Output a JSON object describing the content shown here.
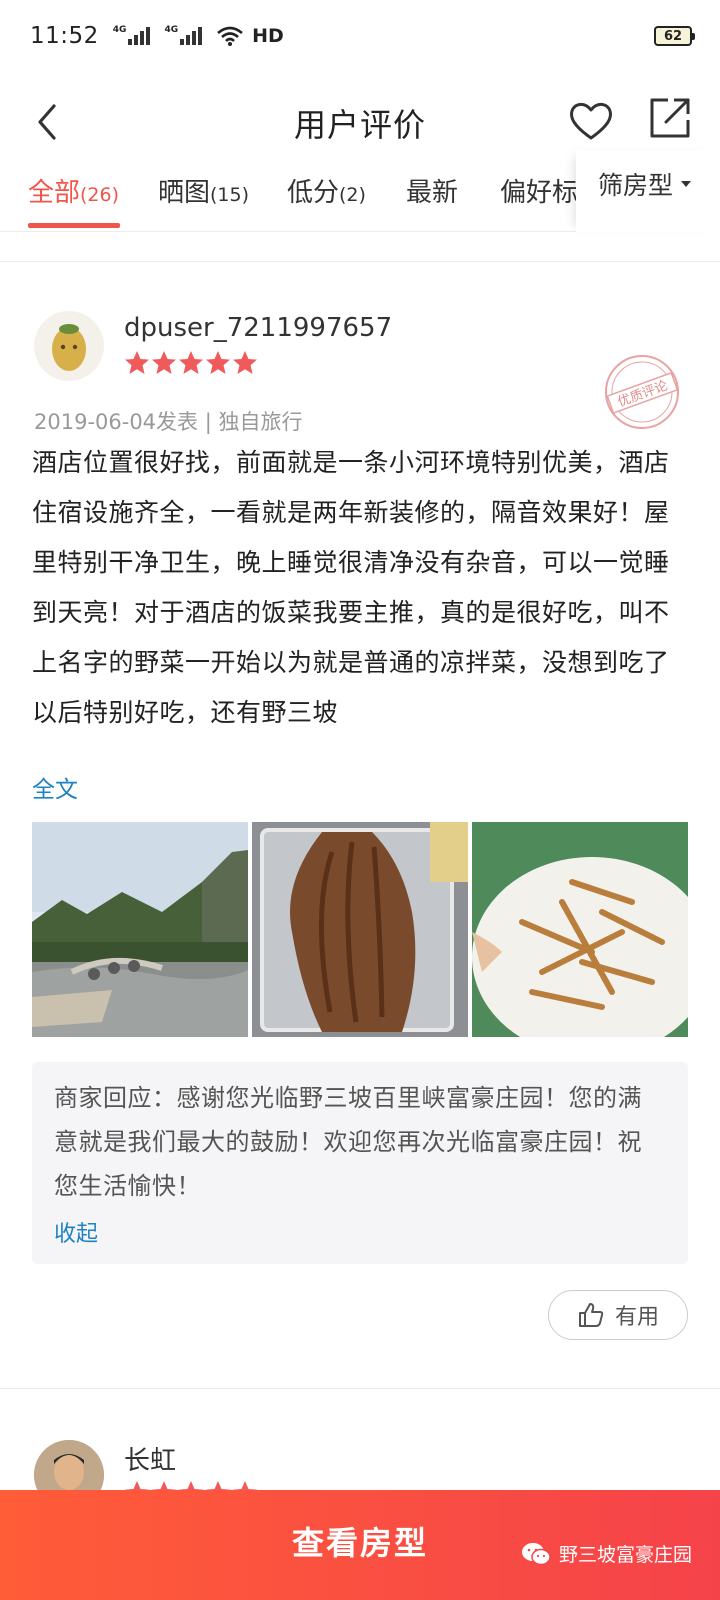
{
  "status_bar": {
    "time": "11:52",
    "signal1_label": "4G",
    "signal2_label": "4G",
    "hd_label": "HD",
    "battery": "62"
  },
  "nav": {
    "title": "用户评价",
    "icons": [
      "back-icon",
      "heart-icon",
      "share-icon"
    ]
  },
  "tabs": [
    {
      "label": "全部",
      "count": "(26)",
      "active": true
    },
    {
      "label": "晒图",
      "count": "(15)"
    },
    {
      "label": "低分",
      "count": "(2)"
    },
    {
      "label": "最新",
      "count": ""
    },
    {
      "label": "偏好标",
      "count": ""
    }
  ],
  "filter": {
    "label": "筛房型"
  },
  "reviews": [
    {
      "username": "dpuser_7211997657",
      "rating": 5,
      "stamp": "优质评论",
      "meta": "2019-06-04发表 | 独自旅行",
      "text": "酒店位置很好找，前面就是一条小河环境特别优美，酒店住宿设施齐全，一看就是两年新装修的，隔音效果好！屋里特别干净卫生，晚上睡觉很清净没有杂音，可以一觉睡到天亮！对于酒店的饭菜我要主推，真的是很好吃，叫不上名字的野菜一开始以为就是普通的凉拌菜，没想到吃了以后特别好吃，还有野三坡",
      "full_link": "全文",
      "reply": "商家回应：感谢您光临野三坡百里峡富豪庄园！您的满意就是我们最大的鼓励！欢迎您再次光临富豪庄园！祝您生活愉快！",
      "collapse_link": "收起",
      "useful_label": "有用"
    },
    {
      "username": "长虹",
      "rating": 5
    }
  ],
  "bottom": {
    "button_label": "查看房型",
    "watermark": "野三坡富豪庄园"
  },
  "colors": {
    "accent": "#f0554a",
    "link": "#1e82c3",
    "star": "#f05a5a",
    "bottom_bar": "#f5434a"
  }
}
